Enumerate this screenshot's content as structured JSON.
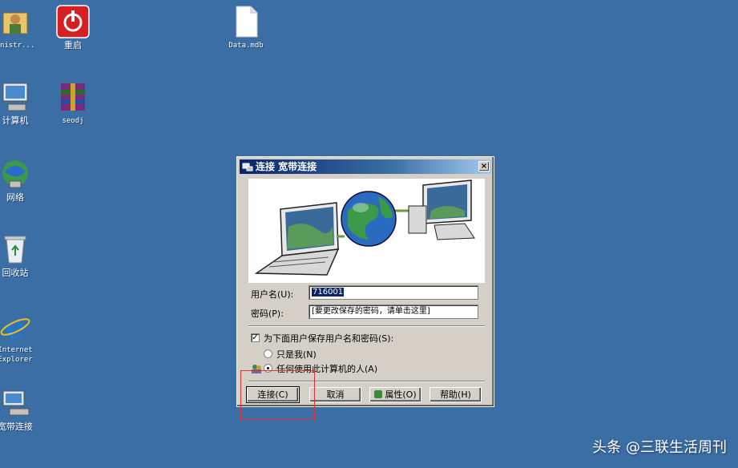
{
  "desktop": {
    "background": "#3a6ea5",
    "icons": [
      {
        "label": "inistr...",
        "icon": "admin-folder-icon"
      },
      {
        "label": "重启",
        "icon": "power-icon"
      },
      {
        "label": "Data.mdb",
        "icon": "document-icon"
      },
      {
        "label": "计算机",
        "icon": "computer-icon"
      },
      {
        "label": "seodj",
        "icon": "winrar-icon"
      },
      {
        "label": "网络",
        "icon": "network-icon"
      },
      {
        "label": "回收站",
        "icon": "recycle-bin-icon"
      },
      {
        "label": "Internet",
        "label2": "Explorer",
        "icon": "ie-icon"
      },
      {
        "label": "宽带连接",
        "icon": "broadband-icon"
      }
    ]
  },
  "dialog": {
    "title": "连接 宽带连接",
    "close": "×",
    "username_label": "用户名(U):",
    "username_value": "716001",
    "password_label": "密码(P):",
    "password_placeholder": "[要更改保存的密码，请单击这里]",
    "save_checkbox_label": "为下面用户保存用户名和密码(S):",
    "save_checked": true,
    "radio_me_label": "只是我(N)",
    "radio_anyone_label": "任何使用此计算机的人(A)",
    "selected_radio": "anyone",
    "buttons": {
      "connect": "连接(C)",
      "cancel": "取消",
      "properties": "属性(O)",
      "help": "帮助(H)"
    }
  },
  "watermark": "头条 @三联生活周刊"
}
